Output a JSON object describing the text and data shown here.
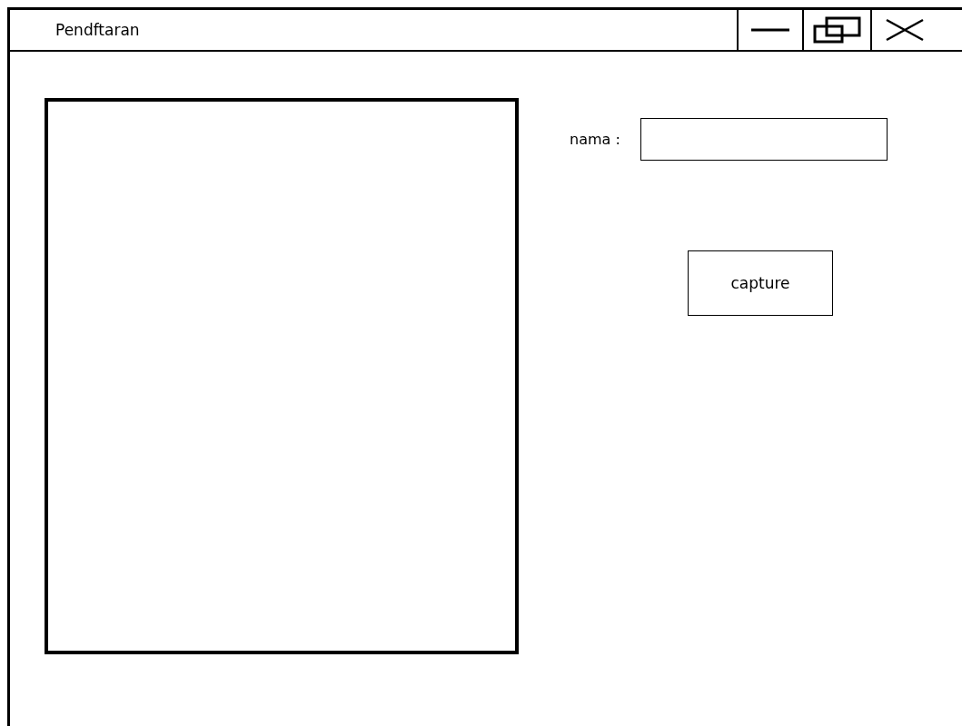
{
  "window": {
    "title": "Pendftaran"
  },
  "form": {
    "name_label": "nama :",
    "capture_button": "capture"
  }
}
